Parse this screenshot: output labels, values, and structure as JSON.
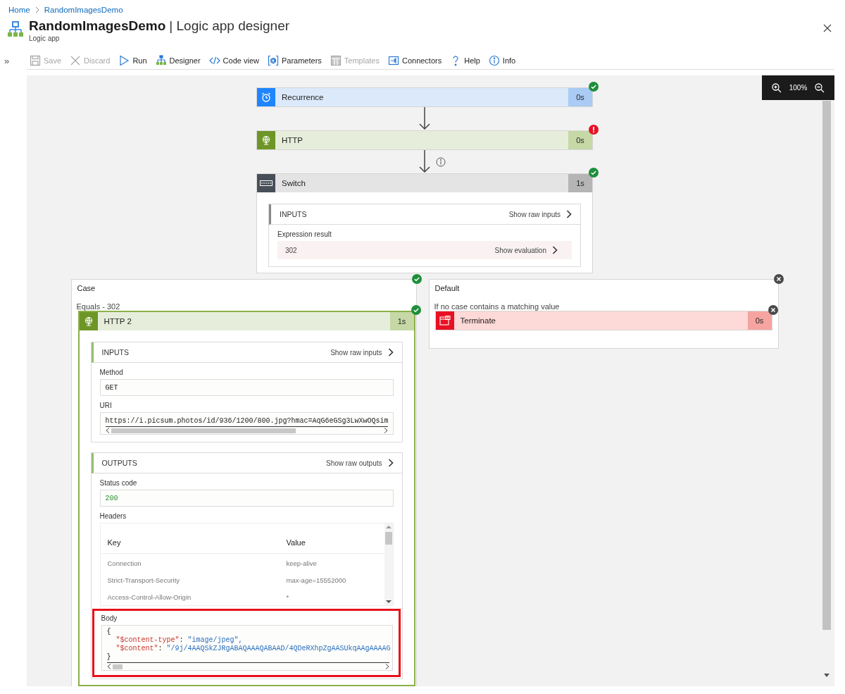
{
  "breadcrumb": [
    {
      "label": "Home"
    },
    {
      "label": "RandomImagesDemo"
    }
  ],
  "header": {
    "title": "RandomImagesDemo",
    "title_suffix": "| Logic app designer",
    "subtitle": "Logic app"
  },
  "toolbar": {
    "expand_glyph": "»",
    "items": [
      {
        "label": "Save",
        "disabled": true
      },
      {
        "label": "Discard",
        "disabled": true
      },
      {
        "label": "Run",
        "disabled": false
      },
      {
        "label": "Designer",
        "disabled": false
      },
      {
        "label": "Code view",
        "disabled": false
      },
      {
        "label": "Parameters",
        "disabled": false
      },
      {
        "label": "Templates",
        "disabled": true
      },
      {
        "label": "Connectors",
        "disabled": false
      },
      {
        "label": "Help",
        "disabled": false
      },
      {
        "label": "Info",
        "disabled": false
      }
    ]
  },
  "zoom": {
    "value": "100%"
  },
  "steps": [
    {
      "kind": "recurrence",
      "title": "Recurrence",
      "duration": "0s",
      "succeeded": true,
      "failed": false,
      "connector_info": false
    },
    {
      "kind": "http",
      "title": "HTTP",
      "duration": "0s",
      "succeeded": false,
      "failed": true,
      "connector_info": true
    },
    {
      "kind": "switch",
      "title": "Switch",
      "duration": "1s",
      "succeeded": true,
      "failed": false,
      "inputs": {
        "heading": "INPUTS",
        "raw_link": "Show raw inputs",
        "expression_label": "Expression result",
        "expression_value": "302",
        "evaluation_link": "Show evaluation"
      }
    }
  ],
  "branches": [
    {
      "kind": "case",
      "title": "Case",
      "succeeded": true,
      "failed": false,
      "condition": "Equals - 302",
      "action": {
        "kind": "http",
        "title": "HTTP 2",
        "duration": "1s",
        "succeeded": true,
        "failed": false,
        "inputs": {
          "heading": "INPUTS",
          "raw_link": "Show raw inputs",
          "fields": [
            {
              "label": "Method",
              "value": "GET",
              "scroll": false
            },
            {
              "label": "URI",
              "value": "https://i.picsum.photos/id/936/1200/800.jpg?hmac=AqG6eGSg3LwXwOQsim",
              "scroll": true
            }
          ]
        },
        "outputs": {
          "heading": "OUTPUTS",
          "raw_link": "Show raw outputs",
          "status_label": "Status code",
          "status_value": "200",
          "headers_label": "Headers",
          "headers_columns": [
            "Key",
            "Value"
          ],
          "headers_rows": [
            [
              "Connection",
              "keep-alive"
            ],
            [
              "Strict-Transport-Security",
              "max-age=15552000"
            ],
            [
              "Access-Control-Allow-Origin",
              "*"
            ]
          ],
          "body": {
            "label": "Body",
            "highlighted": true,
            "lines": [
              {
                "kind": "brace",
                "text": "{"
              },
              {
                "kind": "pair",
                "key": "\"$content-type\"",
                "sep": ": ",
                "value": "\"image/jpeg\","
              },
              {
                "kind": "pair",
                "key": "\"$content\"",
                "sep": ": ",
                "value": "\"/9j/4AAQSkZJRgABAQAAAQABAAD/4QDeRXhpZgAASUkqAAgAAAAG"
              },
              {
                "kind": "brace",
                "text": "}"
              }
            ]
          }
        }
      }
    },
    {
      "kind": "default",
      "title": "Default",
      "succeeded": false,
      "failed": false,
      "condition": "If no case contains a matching value",
      "action": {
        "kind": "terminate",
        "title": "Terminate",
        "duration": "0s",
        "succeeded": false,
        "failed": false
      }
    }
  ]
}
